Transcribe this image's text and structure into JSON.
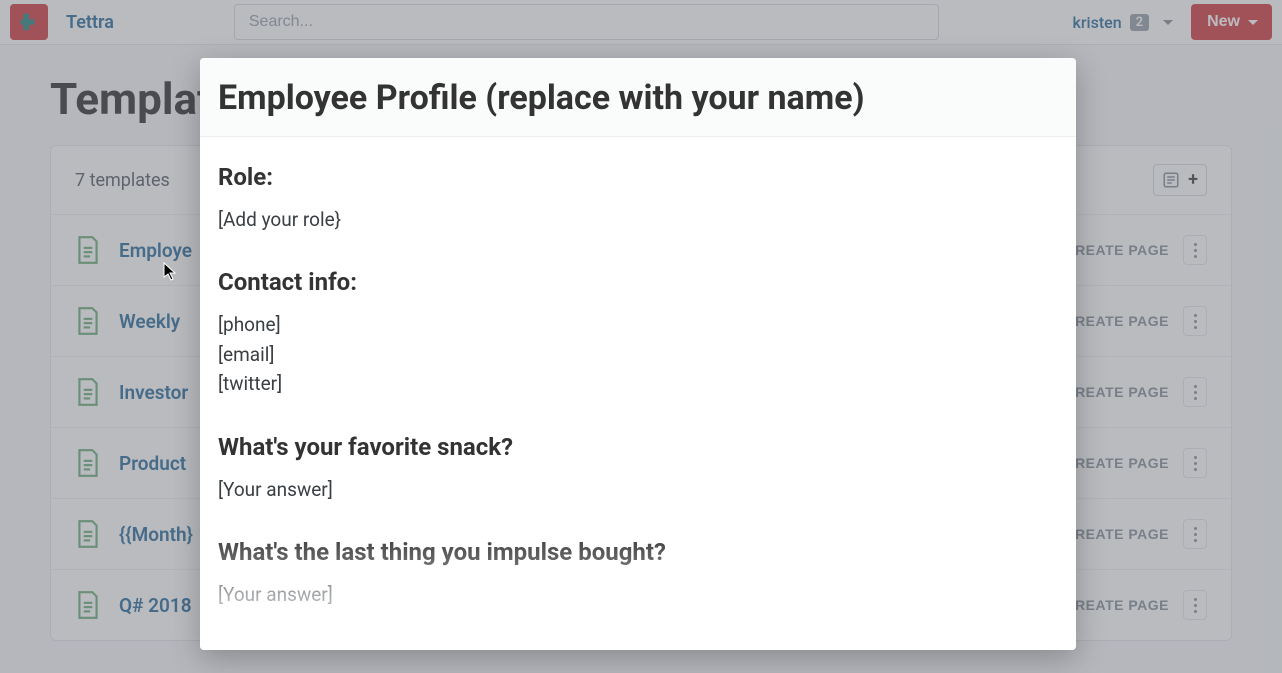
{
  "brand": "Tettra",
  "search": {
    "placeholder": "Search..."
  },
  "user": {
    "name": "kristen",
    "badge": "2"
  },
  "new_label": "New",
  "page_title": "Templates",
  "templates_count_label": "7 templates",
  "create_page_label": "REATE PAGE",
  "templates": [
    {
      "name": "Employe"
    },
    {
      "name": "Weekly"
    },
    {
      "name": "Investor"
    },
    {
      "name": "Product"
    },
    {
      "name": "{{Month}"
    },
    {
      "name": "Q# 2018"
    }
  ],
  "modal": {
    "title": "Employee Profile (replace with your name)",
    "sections": [
      {
        "heading": "Role:",
        "lines": [
          "[Add your role}"
        ]
      },
      {
        "heading": "Contact info:",
        "lines": [
          "[phone]",
          "[email]",
          "[twitter]"
        ]
      },
      {
        "heading": "What's your favorite snack?",
        "lines": [
          "[Your answer]"
        ]
      },
      {
        "heading": "What's the last thing you impulse bought?",
        "lines": [
          "[Your answer]"
        ]
      }
    ]
  }
}
